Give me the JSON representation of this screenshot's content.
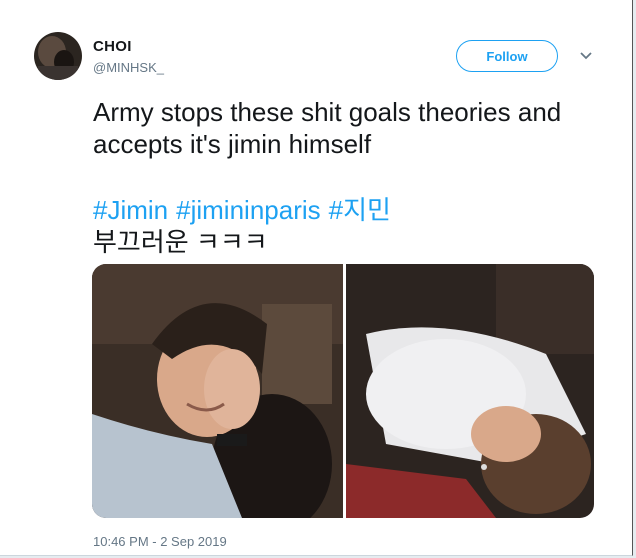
{
  "tweet": {
    "display_name": "CHOI",
    "handle": "@MINHSK_",
    "follow_label": "Follow",
    "text_line1": "Army stops these shit goals theories and",
    "text_line2": "accepts it's jimin himself",
    "hashtags": [
      "#Jimin",
      "#jimininparis",
      "#지민"
    ],
    "korean_text": "부끄러운 ㅋㅋㅋ",
    "timestamp": "10:46 PM - 2 Sep 2019"
  },
  "colors": {
    "accent": "#1da1f2",
    "text": "#14171a",
    "muted": "#657786"
  },
  "icons": {
    "menu": "chevron-down-icon"
  }
}
